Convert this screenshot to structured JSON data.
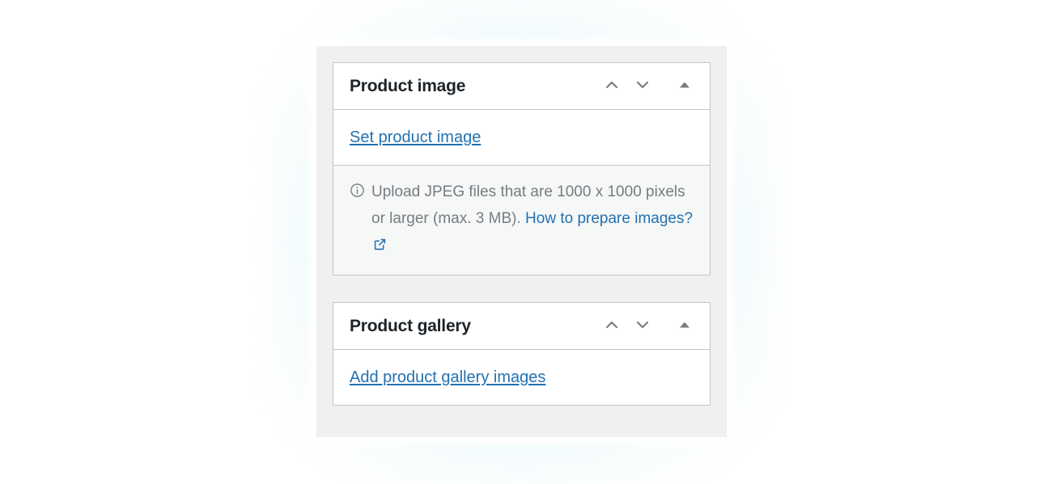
{
  "theme": {
    "accent_blue": "#2271b1",
    "text_dark": "#1d2327",
    "text_muted": "#787c82",
    "panel_border": "#c3c4c7",
    "container_bg": "#f0f0f1",
    "notice_bg": "#f6f7f7",
    "glow": "#d6f0f4"
  },
  "panels": [
    {
      "id": "product-image",
      "title": "Product image",
      "actions": {
        "move_up_label": "Move up",
        "move_down_label": "Move down",
        "toggle_label": "Toggle panel"
      },
      "link_label": "Set product image",
      "notice": {
        "icon": "info-icon",
        "text_before": "Upload JPEG files that are 1000 x 1000 pixels or larger (max. 3 MB).",
        "link_label": "How to prepare images?",
        "link_icon": "external-link-icon"
      }
    },
    {
      "id": "product-gallery",
      "title": "Product gallery",
      "actions": {
        "move_up_label": "Move up",
        "move_down_label": "Move down",
        "toggle_label": "Toggle panel"
      },
      "link_label": "Add product gallery images"
    }
  ]
}
